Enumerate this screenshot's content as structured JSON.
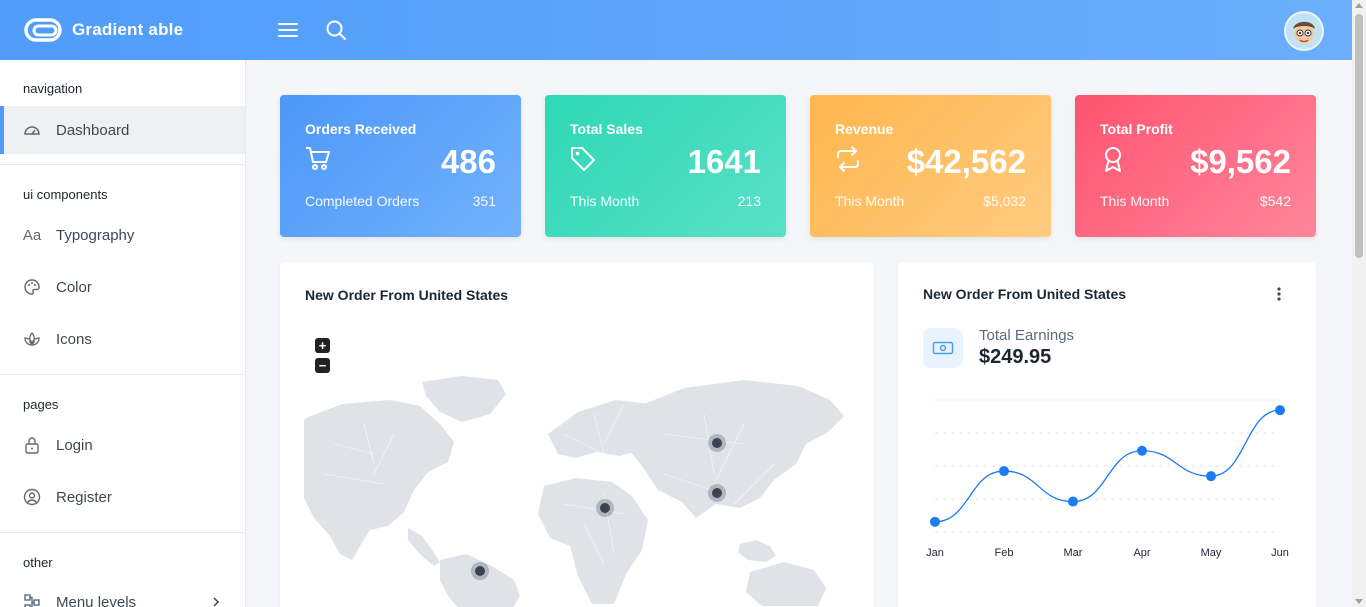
{
  "header": {
    "brand": "Gradient able"
  },
  "sidebar": {
    "sections": [
      {
        "caption": "navigation",
        "items": [
          {
            "label": "Dashboard",
            "icon": "dashboard-gauge-icon",
            "active": true
          }
        ]
      },
      {
        "caption": "ui components",
        "items": [
          {
            "label": "Typography",
            "icon": "typography-icon"
          },
          {
            "label": "Color",
            "icon": "palette-icon"
          },
          {
            "label": "Icons",
            "icon": "flower-icon"
          }
        ]
      },
      {
        "caption": "pages",
        "items": [
          {
            "label": "Login",
            "icon": "lock-icon"
          },
          {
            "label": "Register",
            "icon": "user-circle-icon"
          }
        ]
      },
      {
        "caption": "other",
        "items": [
          {
            "label": "Menu levels",
            "icon": "menu-levels-icon"
          }
        ]
      }
    ]
  },
  "stats": [
    {
      "title": "Orders Received",
      "value": "486",
      "sub_label": "Completed Orders",
      "sub_value": "351",
      "icon": "cart-icon",
      "gradient": [
        "#4c97f8",
        "#72b2fc"
      ]
    },
    {
      "title": "Total Sales",
      "value": "1641",
      "sub_label": "This Month",
      "sub_value": "213",
      "icon": "tag-icon",
      "gradient": [
        "#2ed8b6",
        "#59e0c5"
      ]
    },
    {
      "title": "Revenue",
      "value": "$42,562",
      "sub_label": "This Month",
      "sub_value": "$5,032",
      "icon": "repeat-icon",
      "gradient": [
        "#ffb64d",
        "#ffcb80"
      ]
    },
    {
      "title": "Total Profit",
      "value": "$9,562",
      "sub_label": "This Month",
      "sub_value": "$542",
      "icon": "award-icon",
      "gradient": [
        "#ff5370",
        "#ff869a"
      ]
    }
  ],
  "map_card": {
    "title": "New Order From United States",
    "zoom_in": "+",
    "zoom_out": "−"
  },
  "earnings_card": {
    "title": "New Order From United States",
    "label": "Total Earnings",
    "value": "$249.95"
  },
  "chart_data": {
    "type": "line",
    "categories": [
      "Jan",
      "Feb",
      "Mar",
      "Apr",
      "May",
      "Jun"
    ],
    "series": [
      {
        "values": [
          10,
          60,
          30,
          80,
          55,
          120
        ]
      }
    ],
    "ylim": [
      0,
      130
    ],
    "grid": true,
    "color": "#1b7cf4"
  }
}
